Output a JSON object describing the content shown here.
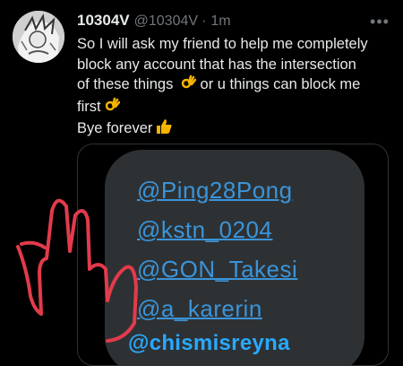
{
  "tweet": {
    "display_name": "10304V",
    "handle": "@10304V",
    "separator": "·",
    "timestamp": "1m",
    "more_icon": "more-horizontal-icon",
    "body_lines": [
      "So I will ask my friend to help me completely",
      "block any account that has the intersection",
      "of these things",
      "or u things can block me",
      "first",
      "Bye forever"
    ],
    "emojis": [
      "ok-hand-emoji",
      "ok-hand-emoji",
      "thumbs-up-emoji"
    ]
  },
  "image": {
    "mentions": [
      "@Ping28Pong",
      "@kstn_0204",
      "@GON_Takesi",
      "@a_karerin"
    ],
    "caption": "@chismisreyna",
    "colors": {
      "mention": "#3b94d9",
      "caption": "#29a9ff",
      "phone_bg": "#2e3133",
      "scribble": "#e23b4c"
    }
  }
}
